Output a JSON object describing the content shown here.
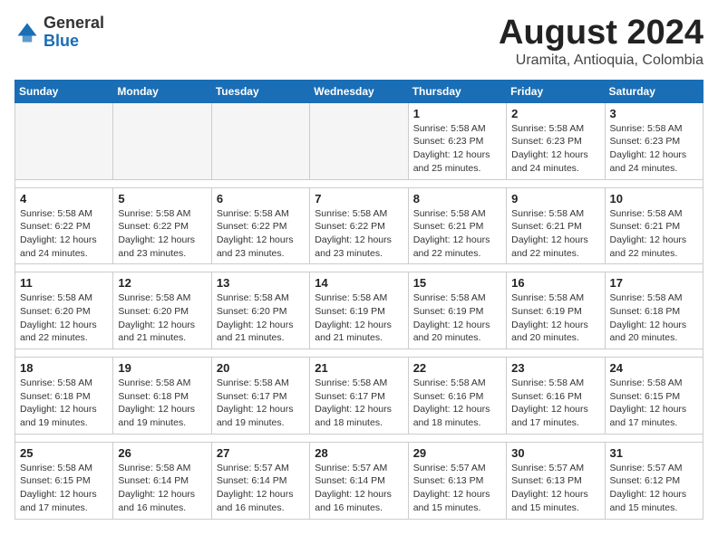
{
  "logo": {
    "general": "General",
    "blue": "Blue"
  },
  "header": {
    "title": "August 2024",
    "subtitle": "Uramita, Antioquia, Colombia"
  },
  "weekdays": [
    "Sunday",
    "Monday",
    "Tuesday",
    "Wednesday",
    "Thursday",
    "Friday",
    "Saturday"
  ],
  "weeks": [
    [
      {
        "day": "",
        "info": ""
      },
      {
        "day": "",
        "info": ""
      },
      {
        "day": "",
        "info": ""
      },
      {
        "day": "",
        "info": ""
      },
      {
        "day": "1",
        "info": "Sunrise: 5:58 AM\nSunset: 6:23 PM\nDaylight: 12 hours\nand 25 minutes."
      },
      {
        "day": "2",
        "info": "Sunrise: 5:58 AM\nSunset: 6:23 PM\nDaylight: 12 hours\nand 24 minutes."
      },
      {
        "day": "3",
        "info": "Sunrise: 5:58 AM\nSunset: 6:23 PM\nDaylight: 12 hours\nand 24 minutes."
      }
    ],
    [
      {
        "day": "4",
        "info": "Sunrise: 5:58 AM\nSunset: 6:22 PM\nDaylight: 12 hours\nand 24 minutes."
      },
      {
        "day": "5",
        "info": "Sunrise: 5:58 AM\nSunset: 6:22 PM\nDaylight: 12 hours\nand 23 minutes."
      },
      {
        "day": "6",
        "info": "Sunrise: 5:58 AM\nSunset: 6:22 PM\nDaylight: 12 hours\nand 23 minutes."
      },
      {
        "day": "7",
        "info": "Sunrise: 5:58 AM\nSunset: 6:22 PM\nDaylight: 12 hours\nand 23 minutes."
      },
      {
        "day": "8",
        "info": "Sunrise: 5:58 AM\nSunset: 6:21 PM\nDaylight: 12 hours\nand 22 minutes."
      },
      {
        "day": "9",
        "info": "Sunrise: 5:58 AM\nSunset: 6:21 PM\nDaylight: 12 hours\nand 22 minutes."
      },
      {
        "day": "10",
        "info": "Sunrise: 5:58 AM\nSunset: 6:21 PM\nDaylight: 12 hours\nand 22 minutes."
      }
    ],
    [
      {
        "day": "11",
        "info": "Sunrise: 5:58 AM\nSunset: 6:20 PM\nDaylight: 12 hours\nand 22 minutes."
      },
      {
        "day": "12",
        "info": "Sunrise: 5:58 AM\nSunset: 6:20 PM\nDaylight: 12 hours\nand 21 minutes."
      },
      {
        "day": "13",
        "info": "Sunrise: 5:58 AM\nSunset: 6:20 PM\nDaylight: 12 hours\nand 21 minutes."
      },
      {
        "day": "14",
        "info": "Sunrise: 5:58 AM\nSunset: 6:19 PM\nDaylight: 12 hours\nand 21 minutes."
      },
      {
        "day": "15",
        "info": "Sunrise: 5:58 AM\nSunset: 6:19 PM\nDaylight: 12 hours\nand 20 minutes."
      },
      {
        "day": "16",
        "info": "Sunrise: 5:58 AM\nSunset: 6:19 PM\nDaylight: 12 hours\nand 20 minutes."
      },
      {
        "day": "17",
        "info": "Sunrise: 5:58 AM\nSunset: 6:18 PM\nDaylight: 12 hours\nand 20 minutes."
      }
    ],
    [
      {
        "day": "18",
        "info": "Sunrise: 5:58 AM\nSunset: 6:18 PM\nDaylight: 12 hours\nand 19 minutes."
      },
      {
        "day": "19",
        "info": "Sunrise: 5:58 AM\nSunset: 6:18 PM\nDaylight: 12 hours\nand 19 minutes."
      },
      {
        "day": "20",
        "info": "Sunrise: 5:58 AM\nSunset: 6:17 PM\nDaylight: 12 hours\nand 19 minutes."
      },
      {
        "day": "21",
        "info": "Sunrise: 5:58 AM\nSunset: 6:17 PM\nDaylight: 12 hours\nand 18 minutes."
      },
      {
        "day": "22",
        "info": "Sunrise: 5:58 AM\nSunset: 6:16 PM\nDaylight: 12 hours\nand 18 minutes."
      },
      {
        "day": "23",
        "info": "Sunrise: 5:58 AM\nSunset: 6:16 PM\nDaylight: 12 hours\nand 17 minutes."
      },
      {
        "day": "24",
        "info": "Sunrise: 5:58 AM\nSunset: 6:15 PM\nDaylight: 12 hours\nand 17 minutes."
      }
    ],
    [
      {
        "day": "25",
        "info": "Sunrise: 5:58 AM\nSunset: 6:15 PM\nDaylight: 12 hours\nand 17 minutes."
      },
      {
        "day": "26",
        "info": "Sunrise: 5:58 AM\nSunset: 6:14 PM\nDaylight: 12 hours\nand 16 minutes."
      },
      {
        "day": "27",
        "info": "Sunrise: 5:57 AM\nSunset: 6:14 PM\nDaylight: 12 hours\nand 16 minutes."
      },
      {
        "day": "28",
        "info": "Sunrise: 5:57 AM\nSunset: 6:14 PM\nDaylight: 12 hours\nand 16 minutes."
      },
      {
        "day": "29",
        "info": "Sunrise: 5:57 AM\nSunset: 6:13 PM\nDaylight: 12 hours\nand 15 minutes."
      },
      {
        "day": "30",
        "info": "Sunrise: 5:57 AM\nSunset: 6:13 PM\nDaylight: 12 hours\nand 15 minutes."
      },
      {
        "day": "31",
        "info": "Sunrise: 5:57 AM\nSunset: 6:12 PM\nDaylight: 12 hours\nand 15 minutes."
      }
    ]
  ]
}
